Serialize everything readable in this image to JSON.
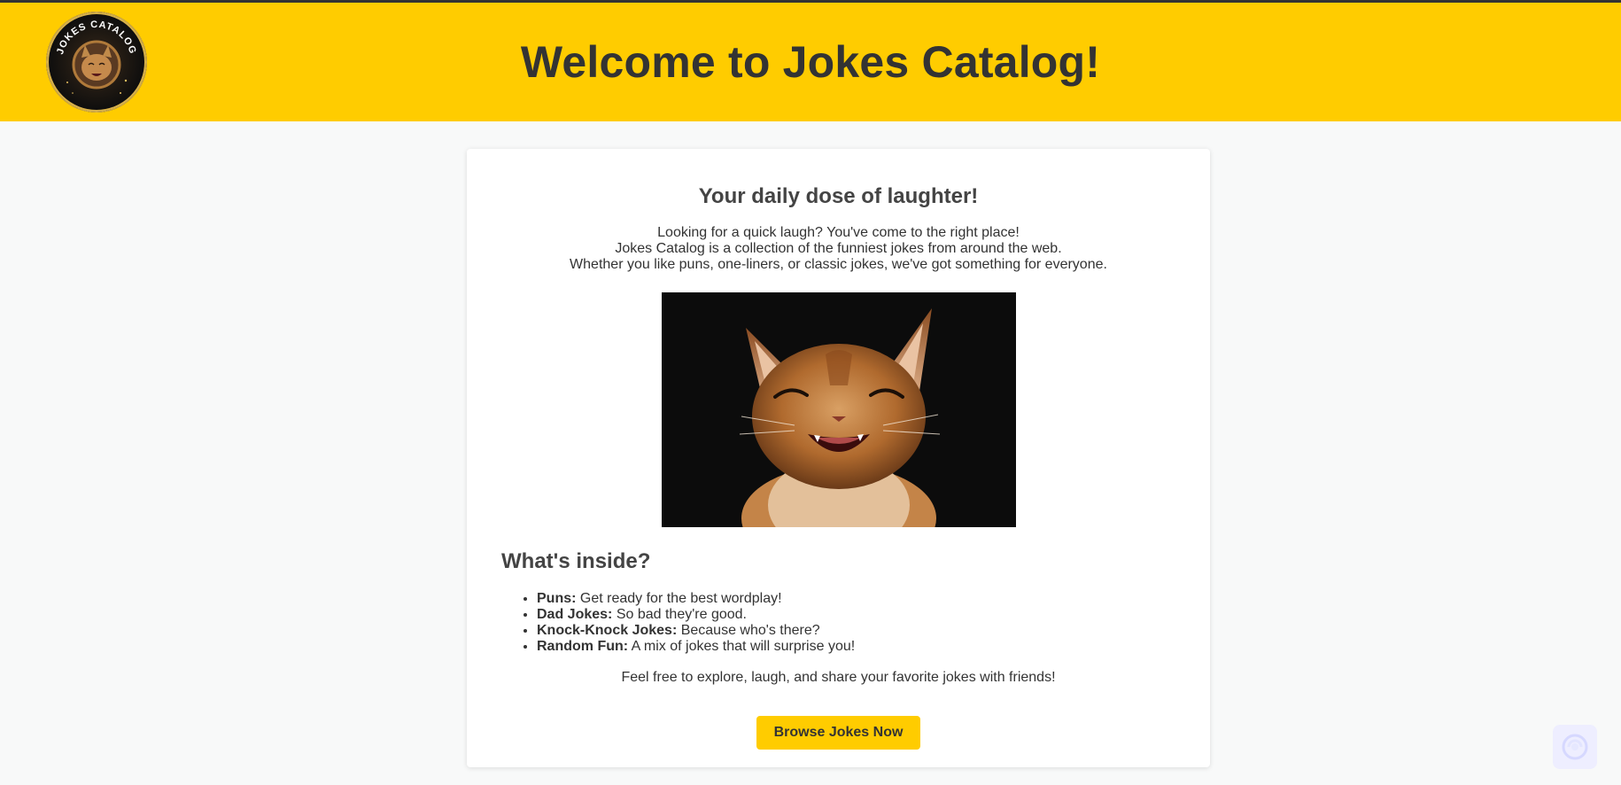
{
  "header": {
    "logo_text": "JOKES CATALOG",
    "title": "Welcome to Jokes Catalog!",
    "background": "#ffcc00",
    "top_border": "#333333"
  },
  "main": {
    "tagline": "Your daily dose of laughter!",
    "intro_lines": [
      "Looking for a quick laugh? You've come to the right place!",
      "Jokes Catalog is a collection of the funniest jokes from around the web.",
      "Whether you like puns, one-liners, or classic jokes, we've got something for everyone."
    ],
    "hero_image": "laughing-kitten-photo",
    "section_heading": "What's inside?",
    "features": [
      {
        "name": "Puns:",
        "desc": " Get ready for the best wordplay!"
      },
      {
        "name": "Dad Jokes:",
        "desc": " So bad they're good."
      },
      {
        "name": "Knock-Knock Jokes:",
        "desc": " Because who's there?"
      },
      {
        "name": "Random Fun:",
        "desc": " A mix of jokes that will surprise you!"
      }
    ],
    "closing": "Feel free to explore, laugh, and share your favorite jokes with friends!",
    "cta_label": "Browse Jokes Now",
    "accent": "#ffcc00"
  },
  "floating": {
    "icon": "assistant-icon"
  }
}
